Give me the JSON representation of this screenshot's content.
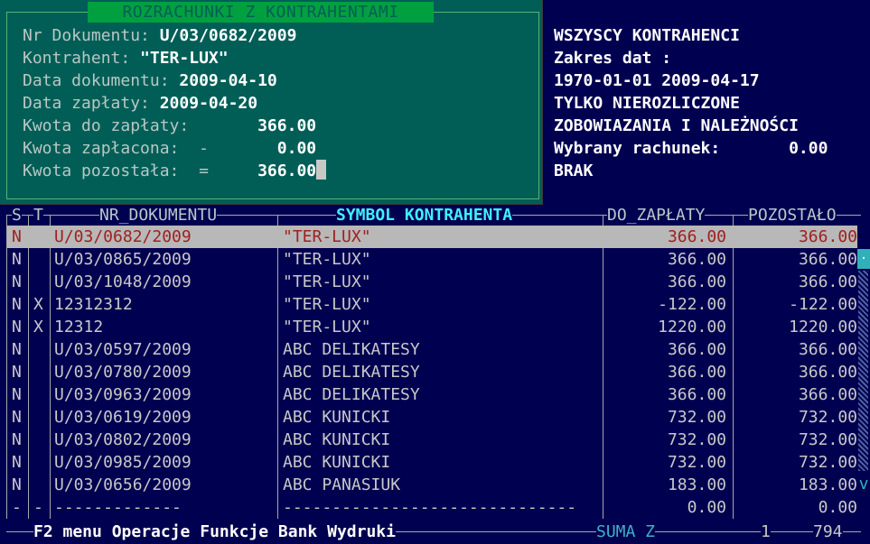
{
  "panel": {
    "title": "ROZRACHUNKI  Z  KONTRAHENTAMI",
    "nr_label": "Nr Dokumentu: ",
    "nr_value": "U/03/0682/2009",
    "kontr_label": "Kontrahent: ",
    "kontr_value": "\"TER-LUX\"",
    "data_dok_label": "Data dokumentu: ",
    "data_dok_value": "2009-04-10",
    "data_zap_label": "Data zapłaty: ",
    "data_zap_value": "2009-04-20",
    "kwota_do_label": "Kwota do zapłaty:       ",
    "kwota_do_value": "366.00",
    "kwota_zap_label": "Kwota zapłacona:  -       ",
    "kwota_zap_value": "0.00",
    "kwota_poz_label": "Kwota pozostała:  =     ",
    "kwota_poz_value": "366.00"
  },
  "info": {
    "line1": "WSZYSCY KONTRAHENCI",
    "line2": "Zakres dat :",
    "line3": "1970-01-01 2009-04-17",
    "line4": "TYLKO NIEROZLICZONE",
    "line5": "ZOBOWIAZANIA I NALEŻNOŚCI",
    "line6": "Wybrany rachunek:       0.00",
    "line7": "BRAK"
  },
  "table": {
    "headers": {
      "s": "S",
      "t": "T",
      "nr": "NR_DOKUMENTU",
      "symbol": "SYMBOL KONTRAHENTA",
      "do_zap": "DO_ZAPŁATY",
      "pozostalo": "POZOSTAŁO"
    },
    "rows": [
      {
        "s": "N",
        "t": "",
        "nr": "U/03/0682/2009",
        "symbol": "\"TER-LUX\"",
        "do_zap": "366.00",
        "poz": "366.00"
      },
      {
        "s": "N",
        "t": "",
        "nr": "U/03/0865/2009",
        "symbol": "\"TER-LUX\"",
        "do_zap": "366.00",
        "poz": "366.00"
      },
      {
        "s": "N",
        "t": "",
        "nr": "U/03/1048/2009",
        "symbol": "\"TER-LUX\"",
        "do_zap": "366.00",
        "poz": "366.00"
      },
      {
        "s": "N",
        "t": "X",
        "nr": "12312312",
        "symbol": "\"TER-LUX\"",
        "do_zap": "-122.00",
        "poz": "-122.00"
      },
      {
        "s": "N",
        "t": "X",
        "nr": "12312",
        "symbol": "\"TER-LUX\"",
        "do_zap": "1220.00",
        "poz": "1220.00"
      },
      {
        "s": "N",
        "t": "",
        "nr": "U/03/0597/2009",
        "symbol": "ABC DELIKATESY",
        "do_zap": "366.00",
        "poz": "366.00"
      },
      {
        "s": "N",
        "t": "",
        "nr": "U/03/0780/2009",
        "symbol": "ABC DELIKATESY",
        "do_zap": "366.00",
        "poz": "366.00"
      },
      {
        "s": "N",
        "t": "",
        "nr": "U/03/0963/2009",
        "symbol": "ABC DELIKATESY",
        "do_zap": "366.00",
        "poz": "366.00"
      },
      {
        "s": "N",
        "t": "",
        "nr": "U/03/0619/2009",
        "symbol": "ABC KUNICKI",
        "do_zap": "732.00",
        "poz": "732.00"
      },
      {
        "s": "N",
        "t": "",
        "nr": "U/03/0802/2009",
        "symbol": "ABC KUNICKI",
        "do_zap": "732.00",
        "poz": "732.00"
      },
      {
        "s": "N",
        "t": "",
        "nr": "U/03/0985/2009",
        "symbol": "ABC KUNICKI",
        "do_zap": "732.00",
        "poz": "732.00"
      },
      {
        "s": "N",
        "t": "",
        "nr": "U/03/0656/2009",
        "symbol": "ABC PANASIUK",
        "do_zap": "183.00",
        "poz": "183.00"
      }
    ],
    "footer": {
      "s": "-",
      "t": "-",
      "nr": "-------------",
      "symbol": "------------------------------",
      "do_zap": "0.00",
      "poz": "0.00"
    }
  },
  "scroll": {
    "up": "·",
    "down": "v"
  },
  "status": {
    "menu": "F2 menu Operacje Funkcje Bank Wydruki",
    "suma": "SUMA Z",
    "page": "1",
    "total": "794"
  }
}
